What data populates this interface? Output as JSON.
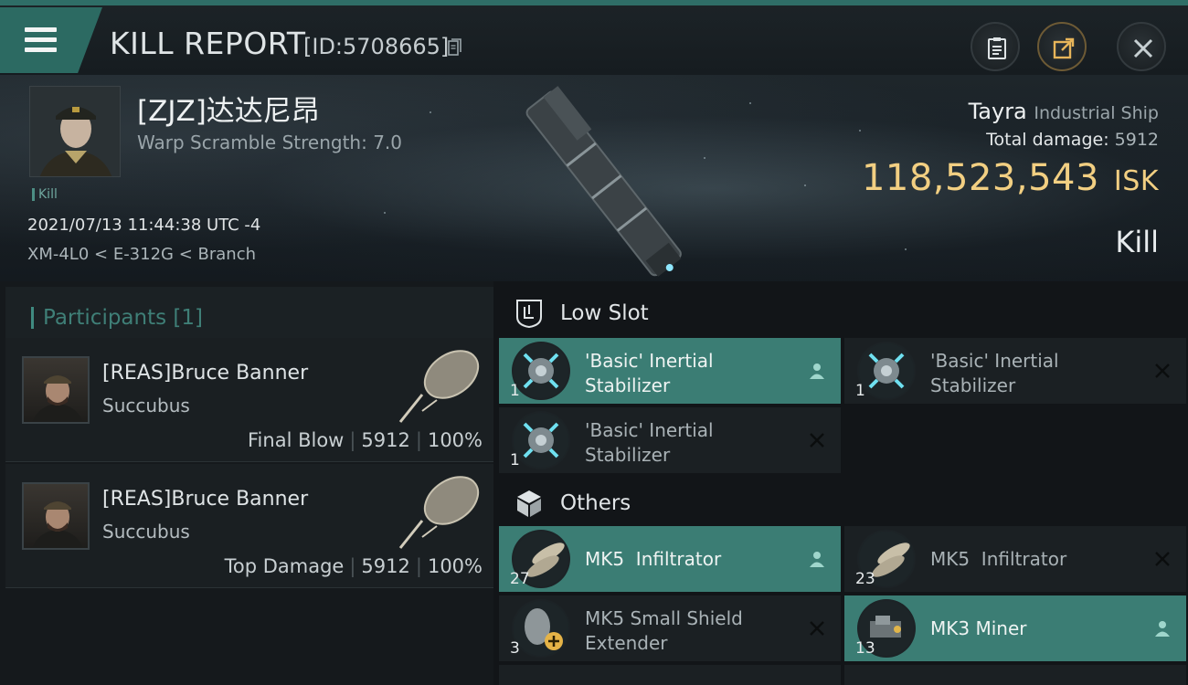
{
  "header": {
    "title": "KILL REPORT",
    "report_id": "[ID:5708665]",
    "icons": [
      "menu-icon",
      "copy-icon",
      "clipboard-icon",
      "share-icon",
      "close-icon"
    ]
  },
  "victim": {
    "name": "[ZJZ]达达尼昂",
    "warp_scramble": "Warp Scramble Strength: 7.0",
    "kill_tag": "Kill",
    "datetime": "2021/07/13 11:44:38 UTC -4",
    "location": "XM-4L0 < E-312G < Branch"
  },
  "ship": {
    "name": "Tayra",
    "class": "Industrial Ship",
    "total_damage_label": "Total damage:",
    "total_damage": "5912",
    "isk_value": "118,523,543",
    "isk_unit": "ISK",
    "result": "Kill"
  },
  "participants": {
    "title": "Participants",
    "count": "[1]",
    "rows": [
      {
        "name": "[REAS]Bruce Banner",
        "ship": "Succubus",
        "role": "Final Blow",
        "damage": "5912",
        "percent": "100%"
      },
      {
        "name": "[REAS]Bruce Banner",
        "ship": "Succubus",
        "role": "Top Damage",
        "damage": "5912",
        "percent": "100%"
      }
    ]
  },
  "sections": {
    "low_slot": {
      "title": "Low Slot",
      "items": [
        {
          "line1": "'Basic' Inertial",
          "line2": "Stabilizer",
          "qty": "1",
          "status": "dropped"
        },
        {
          "line1": "'Basic' Inertial",
          "line2": "Stabilizer",
          "qty": "1",
          "status": "destroyed"
        },
        {
          "line1": "'Basic' Inertial",
          "line2": "Stabilizer",
          "qty": "1",
          "status": "destroyed"
        }
      ]
    },
    "others": {
      "title": "Others",
      "items": [
        {
          "line1": "MK5  Infiltrator",
          "line2": "",
          "qty": "27",
          "status": "dropped"
        },
        {
          "line1": "MK5  Infiltrator",
          "line2": "",
          "qty": "23",
          "status": "destroyed"
        },
        {
          "line1": "MK5 Small Shield",
          "line2": "Extender",
          "qty": "3",
          "status": "destroyed"
        },
        {
          "line1": "MK3 Miner",
          "line2": "",
          "qty": "13",
          "status": "dropped"
        }
      ]
    }
  },
  "colors": {
    "accent": "#2c6a62",
    "dropped_bg": "#3b7d74",
    "isk_gold": "#f2cf82"
  }
}
